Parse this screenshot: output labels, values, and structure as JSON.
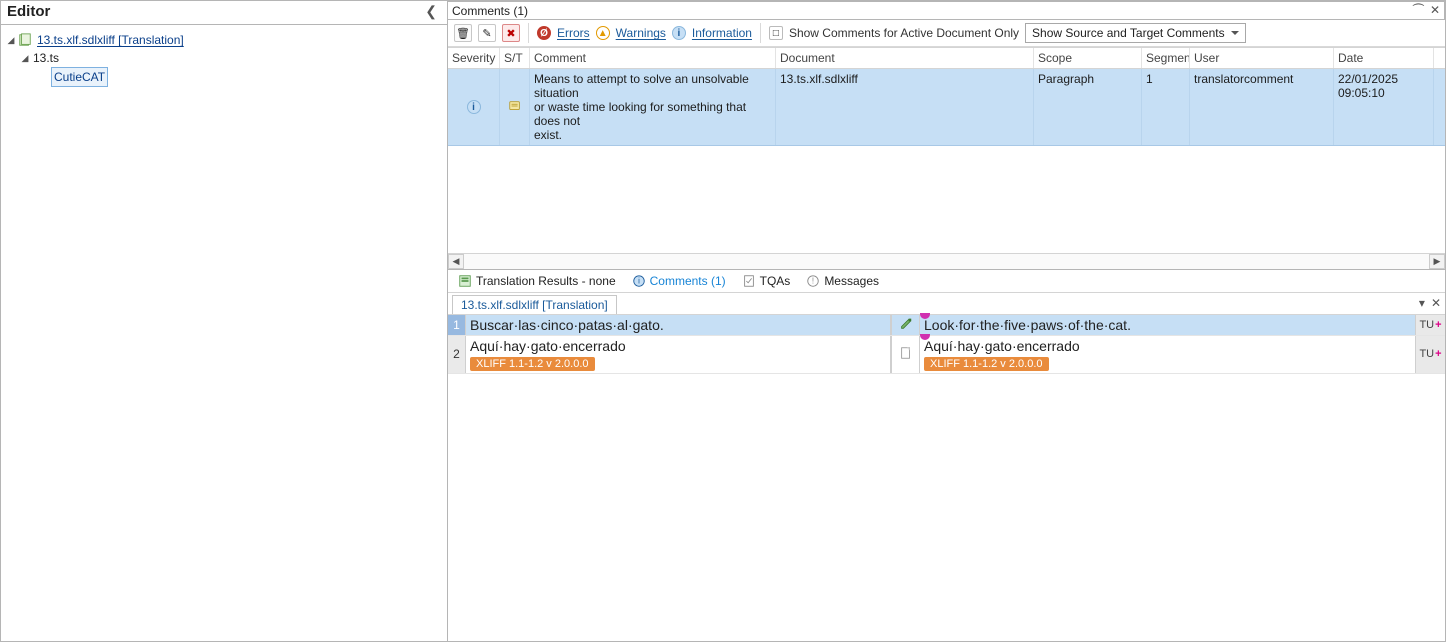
{
  "left": {
    "title": "Editor",
    "tree": {
      "root_label": "13.ts.xlf.sdlxliff [Translation]",
      "child_label": "13.ts",
      "grandchild_label": "CutieCAT"
    }
  },
  "comments_panel": {
    "title": "Comments (1)",
    "toolbar": {
      "errors": "Errors",
      "warnings": "Warnings",
      "information": "Information",
      "active_only": "Show Comments for Active Document Only",
      "source_target_select": "Show Source and Target Comments"
    },
    "columns": {
      "severity": "Severity",
      "st": "S/T",
      "comment": "Comment",
      "document": "Document",
      "scope": "Scope",
      "segment": "Segmen",
      "user": "User",
      "date": "Date"
    },
    "rows": [
      {
        "comment_line1": "Means to attempt to solve an unsolvable situation",
        "comment_line2": "or waste time looking for something that does not",
        "comment_line3": "exist.",
        "document": "13.ts.xlf.sdlxliff",
        "scope": "Paragraph",
        "segment": "1",
        "user": "translatorcomment",
        "date": "22/01/2025 09:05:10"
      }
    ]
  },
  "tabs": {
    "results": "Translation Results - none",
    "comments": "Comments (1)",
    "tqas": "TQAs",
    "messages": "Messages"
  },
  "doc_tab": "13.ts.xlf.sdlxliff [Translation]",
  "segments": [
    {
      "n": "1",
      "source": "Buscar·las·cinco·patas·al·gato.",
      "target": "Look·for·the·five·paws·of·the·cat.",
      "tu": "TU"
    },
    {
      "n": "2",
      "source": "Aquí·hay·gato·encerrado",
      "target": "Aquí·hay·gato·encerrado",
      "tag": "XLIFF 1.1-1.2 v 2.0.0.0",
      "tu": "TU"
    }
  ]
}
